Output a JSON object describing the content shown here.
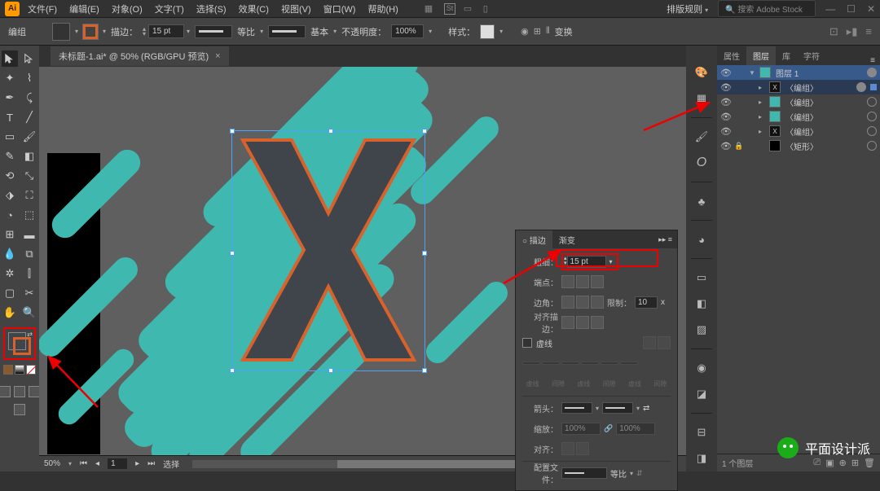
{
  "app": {
    "icon": "Ai"
  },
  "menubar": {
    "file": "文件(F)",
    "edit": "编辑(E)",
    "object": "对象(O)",
    "type": "文字(T)",
    "select": "选择(S)",
    "effect": "效果(C)",
    "view": "视图(V)",
    "window": "窗口(W)",
    "help": "帮助(H)"
  },
  "top_right": {
    "layout_rules": "排版规则",
    "search_placeholder": "搜索 Adobe Stock"
  },
  "controlbar": {
    "group": "编组",
    "stroke_label": "描边：",
    "stroke_weight": "15 pt",
    "uniform": "等比",
    "basic": "基本",
    "opacity_label": "不透明度：",
    "opacity_value": "100%",
    "style_label": "样式：",
    "transform": "变换"
  },
  "document_tab": {
    "name": "未标题-1.ai* @ 50% (RGB/GPU 预览)"
  },
  "statusbar": {
    "zoom": "50%",
    "mode": "选择"
  },
  "stroke_panel": {
    "tab_stroke": "描边",
    "tab_gradient": "渐变",
    "weight_lbl": "粗细：",
    "weight_val": "15 pt",
    "cap_lbl": "端点：",
    "corner_lbl": "边角：",
    "limit_lbl": "限制：",
    "limit_val": "10",
    "limit_unit": "x",
    "align_lbl": "对齐描边：",
    "dashed_lbl": "虚线",
    "dashed_cols": [
      "虚线",
      "间隙",
      "虚线",
      "间隙",
      "虚线",
      "间隙"
    ],
    "arrow_lbl": "箭头：",
    "scale_lbl": "缩放：",
    "scale_val": "100%",
    "align_arrow_lbl": "对齐：",
    "profile_lbl": "配置文件：",
    "profile_val": "等比"
  },
  "right_tabs": {
    "properties": "属性",
    "layers": "图层",
    "libraries": "库",
    "character": "字符"
  },
  "layers": {
    "items": [
      {
        "name": "图层 1",
        "thumb_bg": "#3fb8af",
        "sel": true,
        "eye": true,
        "expand": "▼",
        "target": true,
        "depth": 0
      },
      {
        "name": "〈编组〉",
        "thumb_bg": "#111",
        "thumb_txt": "X",
        "sel": false,
        "hilite": true,
        "eye": true,
        "expand": "▸",
        "target": true,
        "sq": true,
        "depth": 1
      },
      {
        "name": "〈编组〉",
        "thumb_bg": "#3fb8af",
        "eye": true,
        "expand": "▸",
        "target": false,
        "depth": 1
      },
      {
        "name": "〈编组〉",
        "thumb_bg": "#3fb8af",
        "eye": true,
        "expand": "▸",
        "target": false,
        "depth": 1
      },
      {
        "name": "〈编组〉",
        "thumb_bg": "#111",
        "thumb_txt": "X",
        "eye": true,
        "expand": "▸",
        "target": false,
        "depth": 1
      },
      {
        "name": "〈矩形〉",
        "thumb_bg": "#000",
        "eye": true,
        "lock": true,
        "expand": "",
        "target": false,
        "depth": 1
      }
    ],
    "footer": "1 个图层"
  },
  "watermark": "平面设计派"
}
